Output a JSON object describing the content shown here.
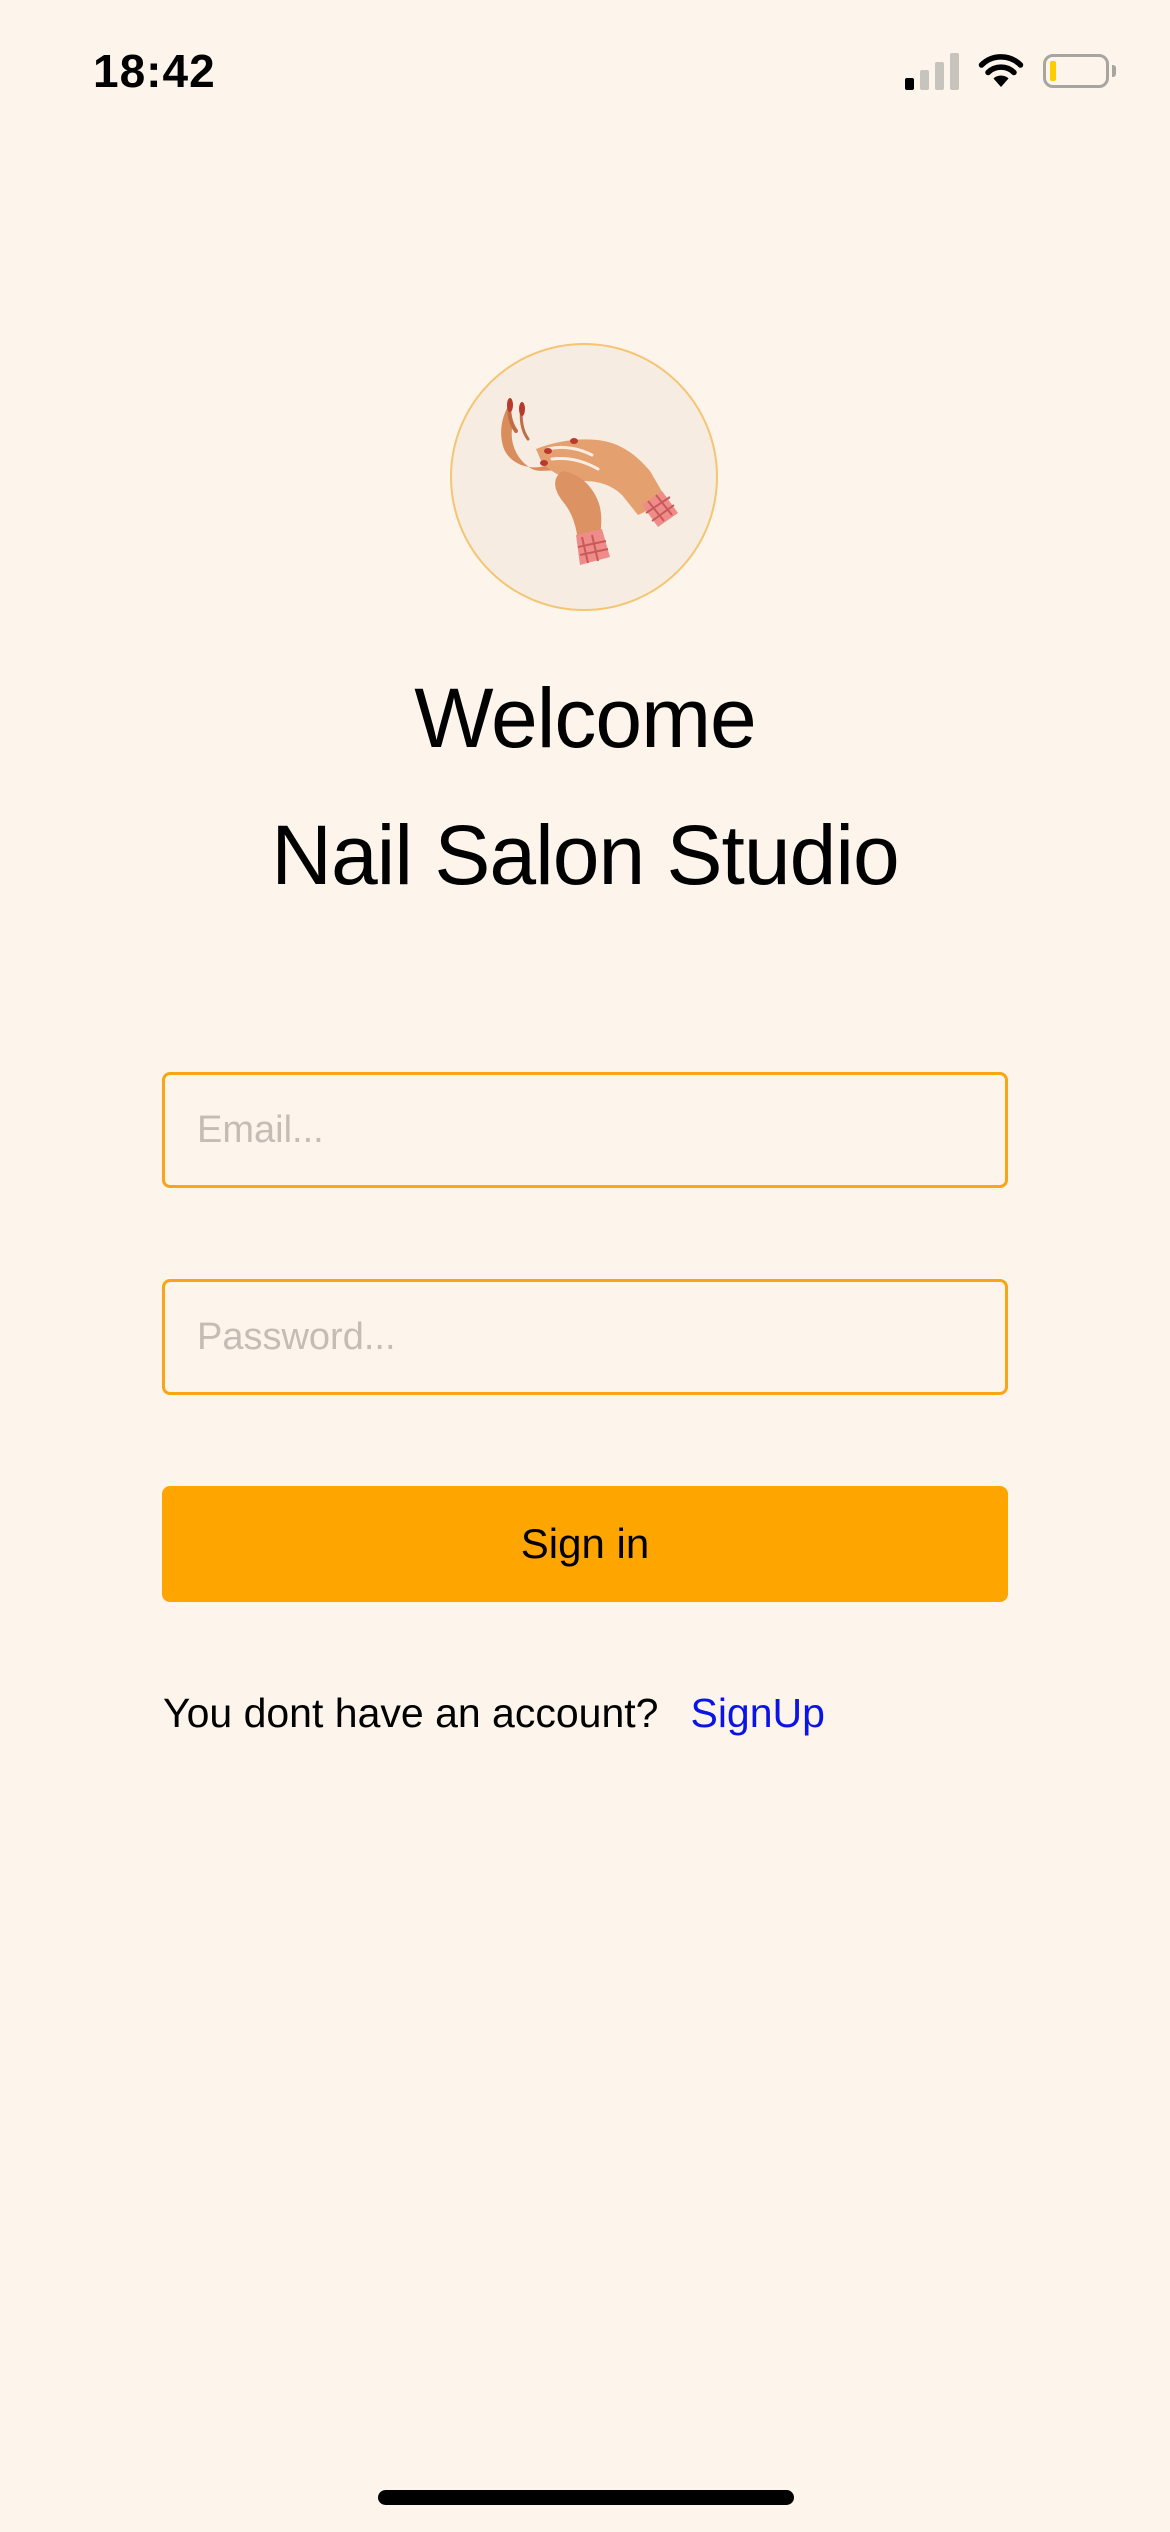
{
  "status_bar": {
    "time": "18:42",
    "signal_icon": "cellular-signal-icon",
    "wifi_icon": "wifi-icon",
    "battery_icon": "battery-icon",
    "battery_color": "#ffcc00"
  },
  "logo": {
    "icon": "hands-manicure-icon",
    "border_color": "#f4c572"
  },
  "header": {
    "welcome": "Welcome",
    "salon_name": "Nail Salon Studio"
  },
  "form": {
    "email_placeholder": "Email...",
    "email_value": "",
    "password_placeholder": "Password...",
    "password_value": "",
    "signin_label": "Sign in"
  },
  "footer": {
    "prompt": "You dont have an account?",
    "signup_label": "SignUp"
  },
  "colors": {
    "background": "#fdf5eb",
    "accent": "#ffa500",
    "field_border": "#f9a51a",
    "link": "#0a14e6"
  }
}
